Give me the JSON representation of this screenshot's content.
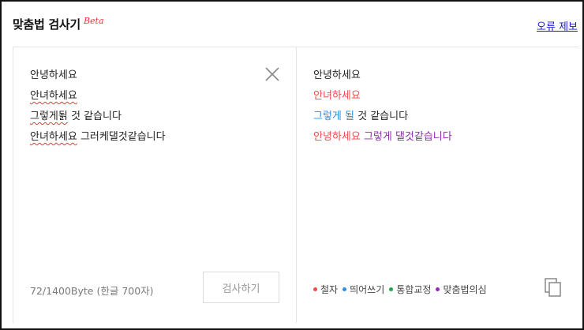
{
  "header": {
    "title": "맞춤법 검사기",
    "badge": "Beta",
    "report_link": "오류 제보"
  },
  "input": {
    "lines": [
      [
        {
          "text": "안녕하세요",
          "error": false
        }
      ],
      [
        {
          "text": "안녀하세요",
          "error": true
        }
      ],
      [
        {
          "text": "그렇게됡",
          "error": true
        },
        {
          "text": " 것 같습니다",
          "error": false
        }
      ],
      [
        {
          "text": "안녀하세요",
          "error": true
        },
        {
          "text": " 그러케댈것같습니다",
          "error": false
        }
      ]
    ],
    "byte_count": "72/1400Byte (한글 700자)",
    "check_button": "검사하기"
  },
  "output": {
    "lines": [
      [
        {
          "text": "안녕하세요",
          "type": "plain"
        }
      ],
      [
        {
          "text": "안녀하세요",
          "type": "spelling"
        }
      ],
      [
        {
          "text": "그렇게 될",
          "type": "spacing"
        },
        {
          "text": " 것 같습니다",
          "type": "plain"
        }
      ],
      [
        {
          "text": "안녕하세요",
          "type": "spelling"
        },
        {
          "text": " 그렇게 댈것같습니다",
          "type": "suspect"
        }
      ]
    ]
  },
  "legend": [
    {
      "label": "철자",
      "type": "spelling"
    },
    {
      "label": "띄어쓰기",
      "type": "spacing"
    },
    {
      "label": "통합교정",
      "type": "combined"
    },
    {
      "label": "맞춤법의심",
      "type": "suspect"
    }
  ],
  "colors": {
    "spelling": "#ee4b4b",
    "spacing": "#2a8ee8",
    "combined": "#1fa84a",
    "suspect": "#8f2bb4",
    "underline": "#e23b3b",
    "link": "#1b1bd6"
  },
  "icons": {
    "clear": "close-icon",
    "copy": "copy-icon"
  }
}
